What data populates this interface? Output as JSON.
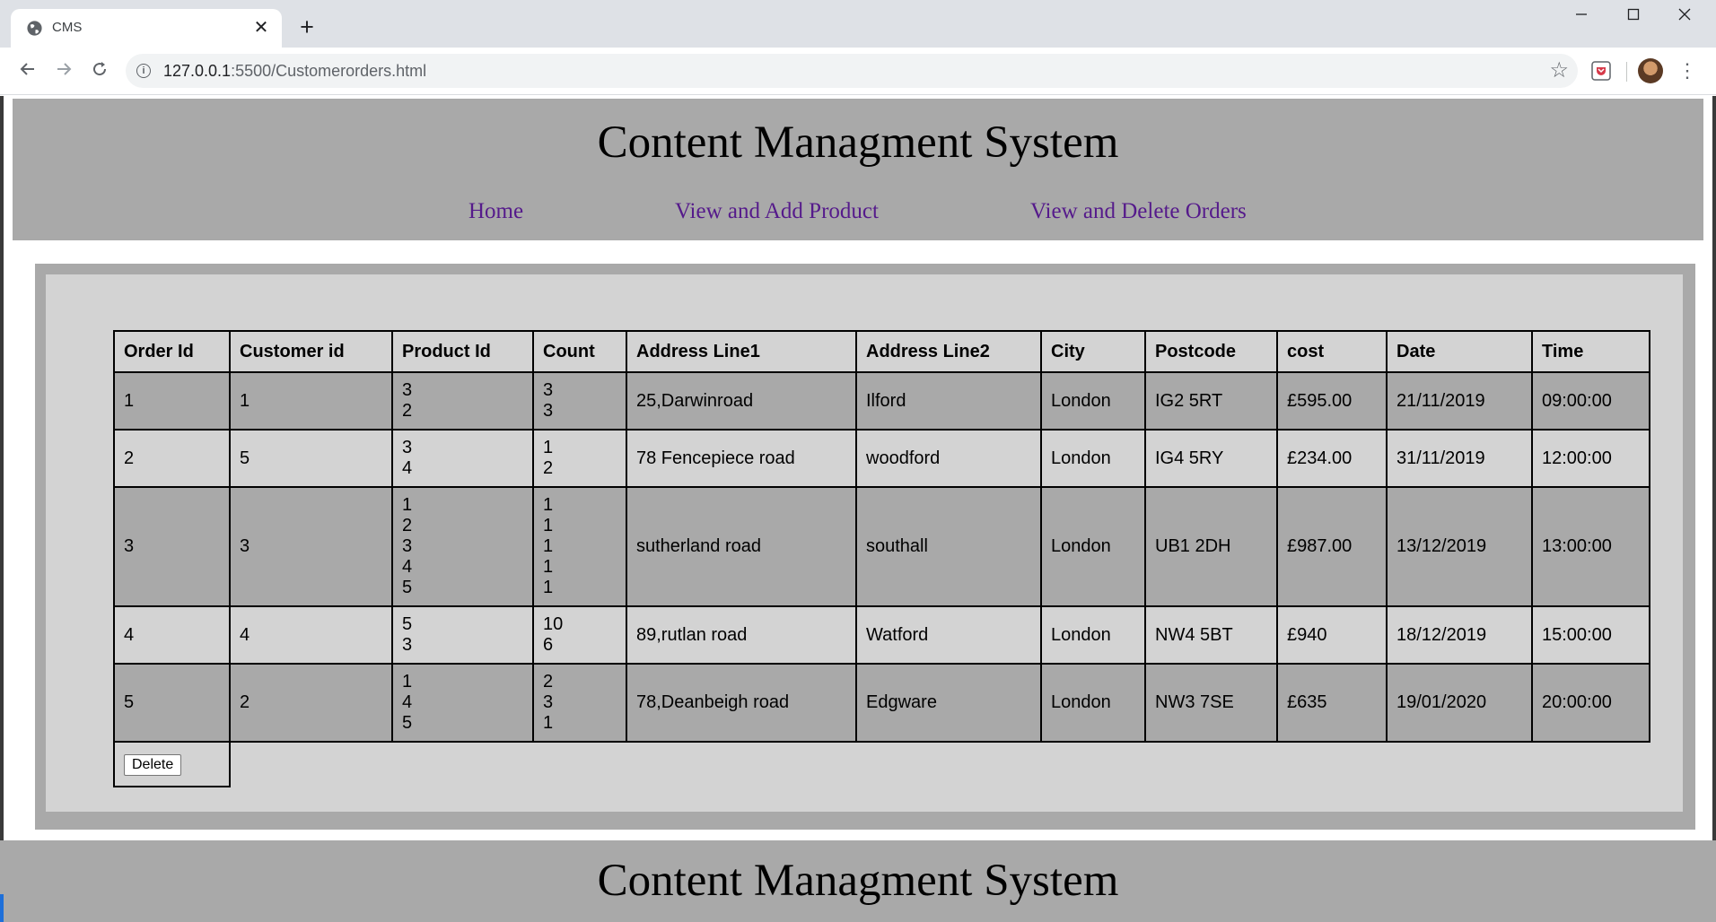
{
  "browser": {
    "tab_title": "CMS",
    "tab_close": "✕",
    "new_tab": "+",
    "url_host": "127.0.0.1",
    "url_path": ":5500/Customerorders.html"
  },
  "site": {
    "title": "Content Managment System",
    "nav": [
      "Home",
      "View and Add Product",
      "View and Delete Orders"
    ],
    "footer_title": "Content Managment System"
  },
  "orders": {
    "headers": [
      "Order Id",
      "Customer id",
      "Product Id",
      "Count",
      "Address Line1",
      "Address Line2",
      "City",
      "Postcode",
      "cost",
      "Date",
      "Time"
    ],
    "rows": [
      {
        "order_id": "1",
        "customer_id": "1",
        "product_ids": [
          "3",
          "2"
        ],
        "counts": [
          "3",
          "3"
        ],
        "address1": "25,Darwinroad",
        "address2": "Ilford",
        "city": "London",
        "postcode": "IG2 5RT",
        "cost": "£595.00",
        "date": "21/11/2019",
        "time": "09:00:00"
      },
      {
        "order_id": "2",
        "customer_id": "5",
        "product_ids": [
          "3",
          "4"
        ],
        "counts": [
          "1",
          "2"
        ],
        "address1": "78 Fencepiece road",
        "address2": "woodford",
        "city": "London",
        "postcode": "IG4 5RY",
        "cost": "£234.00",
        "date": "31/11/2019",
        "time": "12:00:00"
      },
      {
        "order_id": "3",
        "customer_id": "3",
        "product_ids": [
          "1",
          "2",
          "3",
          "4",
          "5"
        ],
        "counts": [
          "1",
          "1",
          "1",
          "1",
          "1"
        ],
        "address1": "sutherland road",
        "address2": "southall",
        "city": "London",
        "postcode": "UB1 2DH",
        "cost": "£987.00",
        "date": "13/12/2019",
        "time": "13:00:00"
      },
      {
        "order_id": "4",
        "customer_id": "4",
        "product_ids": [
          "5",
          "3"
        ],
        "counts": [
          "10",
          "6"
        ],
        "address1": "89,rutlan road",
        "address2": "Watford",
        "city": "London",
        "postcode": "NW4 5BT",
        "cost": "£940",
        "date": "18/12/2019",
        "time": "15:00:00"
      },
      {
        "order_id": "5",
        "customer_id": "2",
        "product_ids": [
          "1",
          "4",
          "5"
        ],
        "counts": [
          "2",
          "3",
          "1"
        ],
        "address1": "78,Deanbeigh road",
        "address2": "Edgware",
        "city": "London",
        "postcode": "NW3 7SE",
        "cost": "£635",
        "date": "19/01/2020",
        "time": "20:00:00"
      }
    ],
    "delete_label": "Delete"
  }
}
